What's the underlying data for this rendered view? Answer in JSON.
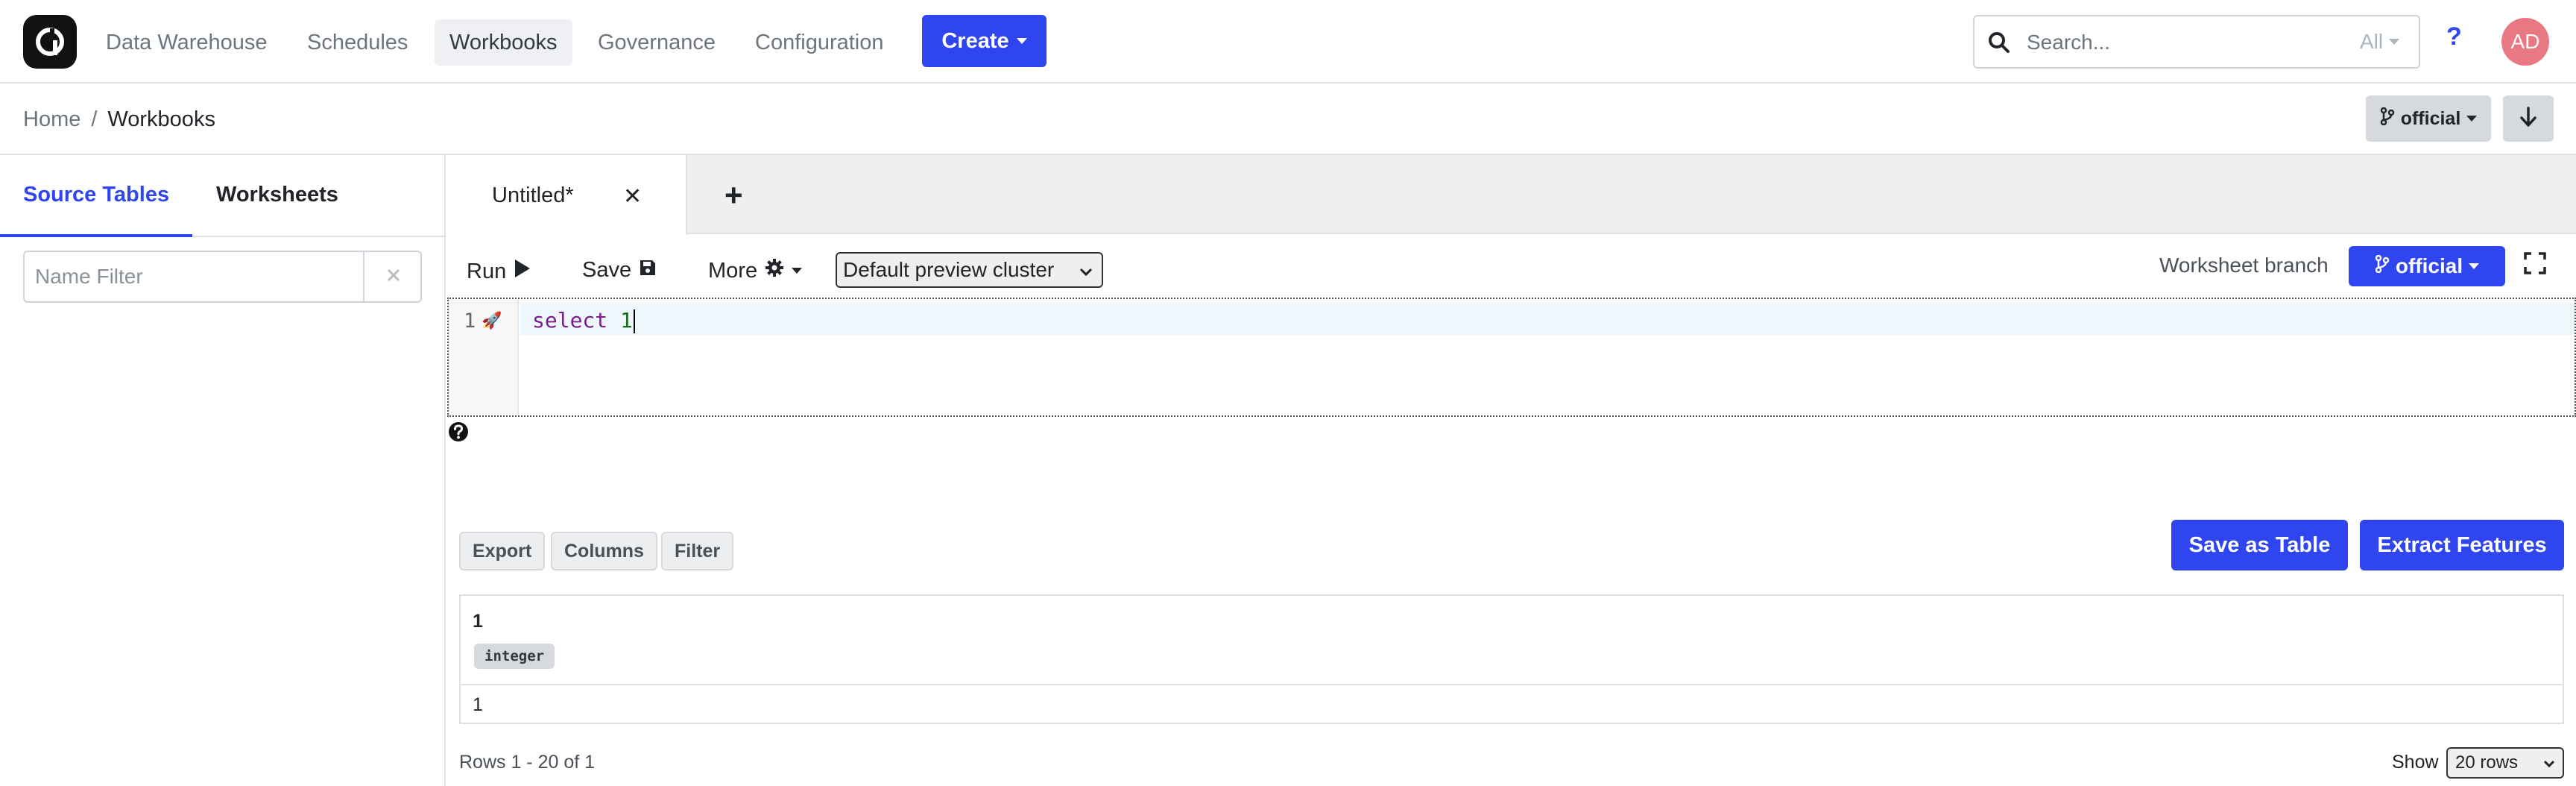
{
  "nav": {
    "items": [
      {
        "label": "Data Warehouse"
      },
      {
        "label": "Schedules"
      },
      {
        "label": "Workbooks"
      },
      {
        "label": "Governance"
      },
      {
        "label": "Configuration"
      }
    ],
    "active": "Workbooks",
    "create_label": "Create",
    "search_placeholder": "Search...",
    "search_scope": "All",
    "help_label": "?",
    "avatar_initials": "AD"
  },
  "breadcrumb": {
    "home": "Home",
    "separator": "/",
    "current": "Workbooks"
  },
  "branch_label": "official",
  "sidebar": {
    "tabs": [
      {
        "label": "Source Tables",
        "active": true
      },
      {
        "label": "Worksheets",
        "active": false
      }
    ],
    "filter_placeholder": "Name Filter"
  },
  "worksheet_tabs": {
    "tabs": [
      {
        "label": "Untitled*"
      }
    ],
    "add_label": "+"
  },
  "toolbar": {
    "run_label": "Run",
    "save_label": "Save",
    "more_label": "More",
    "cluster_selected": "Default preview cluster",
    "worksheet_branch_label": "Worksheet branch",
    "worksheet_branch_value": "official"
  },
  "editor": {
    "line_number": "1",
    "keyword": "select",
    "literal": "1"
  },
  "results": {
    "export_label": "Export",
    "columns_label": "Columns",
    "filter_label": "Filter",
    "save_table_label": "Save as Table",
    "extract_label": "Extract Features",
    "column_name": "1",
    "column_type": "integer",
    "cell_value": "1",
    "rows_info": "Rows 1 - 20 of 1",
    "show_label": "Show",
    "rows_per_page": "20 rows"
  },
  "colors": {
    "primary": "#2f45ef",
    "avatar": "#e97883"
  }
}
